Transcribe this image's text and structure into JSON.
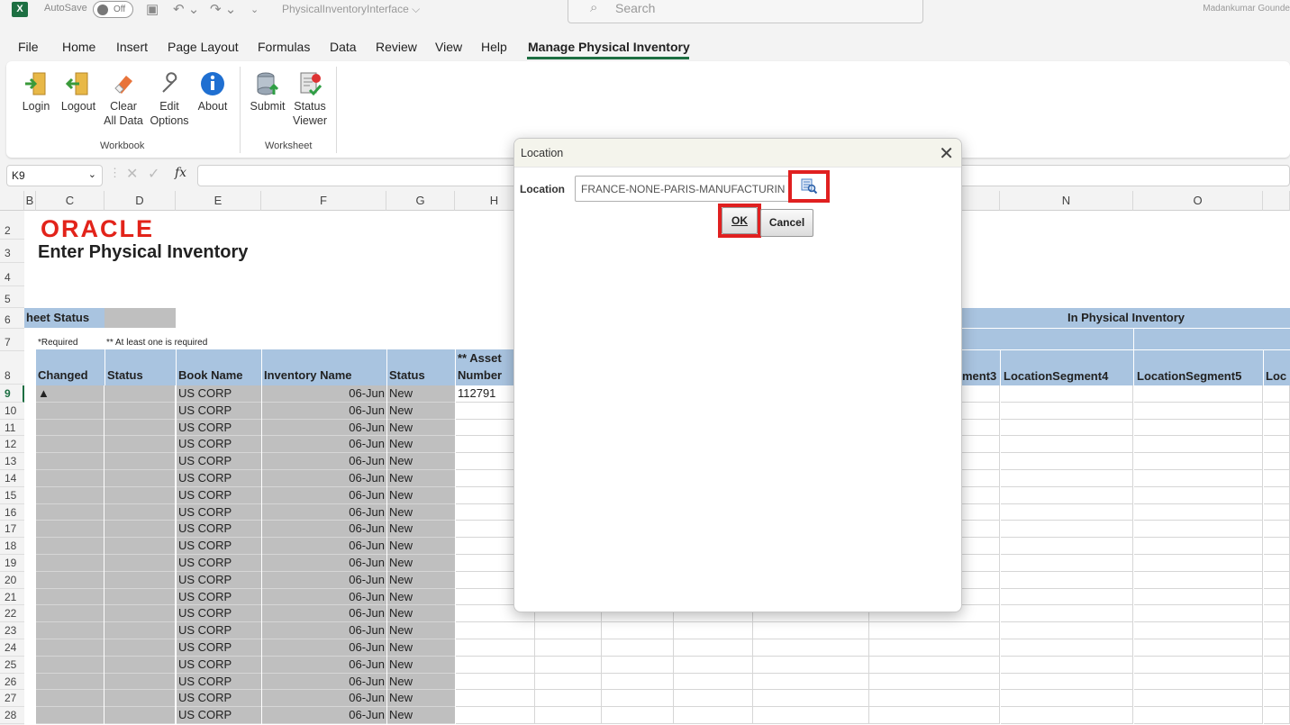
{
  "titlebar": {
    "autosave_label": "AutoSave",
    "autosave_state": "Off",
    "document_name": "PhysicalInventoryInterface ⌵",
    "search_placeholder": "Search",
    "user": "Madankumar Gounde"
  },
  "menu": [
    "File",
    "Home",
    "Insert",
    "Page Layout",
    "Formulas",
    "Data",
    "Review",
    "View",
    "Help",
    "Manage Physical Inventory"
  ],
  "ribbon": {
    "workbook_group_label": "Workbook",
    "worksheet_group_label": "Worksheet",
    "buttons": {
      "login": "Login",
      "logout": "Logout",
      "clear_1": "Clear",
      "clear_2": "All Data",
      "edit_1": "Edit",
      "edit_2": "Options",
      "about": "About",
      "submit": "Submit",
      "status_1": "Status",
      "status_2": "Viewer"
    }
  },
  "formula_bar": {
    "cell_ref": "K9",
    "fx": "fx"
  },
  "columns": {
    "B": "B",
    "C": "C",
    "D": "D",
    "E": "E",
    "F": "F",
    "G": "G",
    "H": "H",
    "N": "N",
    "O": "O"
  },
  "sheet": {
    "brand": "ORACLE",
    "heading": "Enter Physical Inventory",
    "sheet_status_label": "heet Status",
    "in_physical_inventory": "In Physical Inventory",
    "required_note": "*Required",
    "at_least_one_note": "** At least one is required",
    "headers": {
      "changed": "Changed",
      "status": "Status",
      "book_name": "Book Name",
      "inventory_name": "Inventory Name",
      "status2": "Status",
      "asset_1": "** Asset",
      "asset_2": "Number",
      "loc_seg3": "ment3",
      "loc_seg4": "LocationSegment4",
      "loc_seg5": "LocationSegment5",
      "loc_more": "Loc"
    },
    "row_numbers": [
      "2",
      "3",
      "4",
      "5",
      "6",
      "7",
      "8",
      "9",
      "10",
      "11",
      "12",
      "13",
      "14",
      "15",
      "16",
      "17",
      "18",
      "19",
      "20",
      "21",
      "22",
      "23",
      "24",
      "25",
      "26",
      "27",
      "28"
    ],
    "first_changed_marker": "▲",
    "first_asset_number": "112791",
    "book_name": "US CORP",
    "inventory_name": "06-Jun",
    "status_value": "New"
  },
  "modal": {
    "title": "Location",
    "close_label": "✕",
    "field_label": "Location",
    "field_value": "FRANCE-NONE-PARIS-MANUFACTURING",
    "ok_label": "OK",
    "cancel_label": "Cancel"
  }
}
